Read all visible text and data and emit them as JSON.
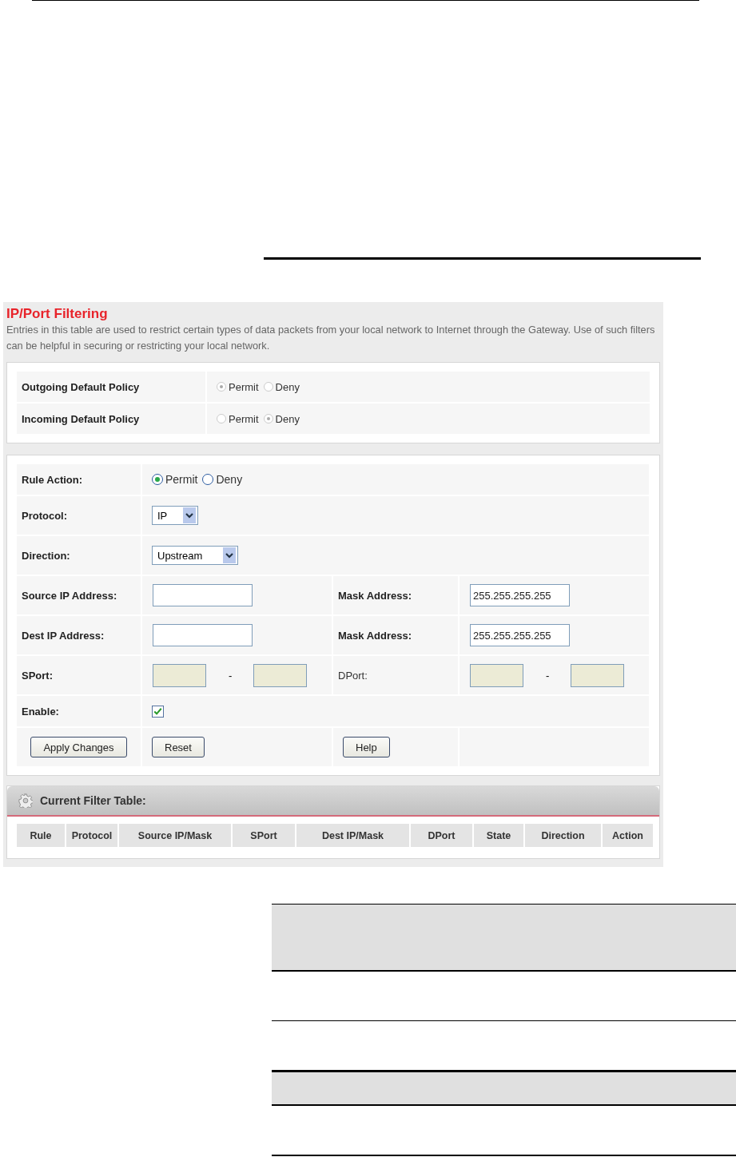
{
  "panel": {
    "title": "IP/Port Filtering",
    "description": "Entries in this table are used to restrict certain types of data packets from your local network to Internet through the Gateway. Use of such filters can be helpful in securing or restricting your local network."
  },
  "policies": [
    {
      "label": "Outgoing Default Policy",
      "disabled": true,
      "options": [
        {
          "label": "Permit",
          "selected": true
        },
        {
          "label": "Deny",
          "selected": false
        }
      ]
    },
    {
      "label": "Incoming Default Policy",
      "disabled": true,
      "options": [
        {
          "label": "Permit",
          "selected": false
        },
        {
          "label": "Deny",
          "selected": true
        }
      ]
    }
  ],
  "form_rows": [
    {
      "kind": "radio",
      "label": "Rule Action:",
      "options": [
        {
          "label": "Permit",
          "selected": true
        },
        {
          "label": "Deny",
          "selected": false
        }
      ]
    },
    {
      "kind": "select",
      "label": "Protocol:",
      "value": "IP"
    },
    {
      "kind": "select",
      "label": "Direction:",
      "value": "Upstream"
    },
    {
      "kind": "address",
      "label": "Source IP Address:",
      "mask_label": "Mask Address:",
      "mask_value": "255.255.255.255"
    },
    {
      "kind": "address",
      "label": "Dest IP Address:",
      "mask_label": "Mask Address:",
      "mask_value": "255.255.255.255"
    },
    {
      "kind": "ports",
      "label": "SPort:",
      "separator": "-",
      "right_label": "DPort:",
      "right_separator": "-",
      "disabled": true
    },
    {
      "kind": "checkbox",
      "label": "Enable:",
      "checked": true
    }
  ],
  "buttons": [
    "Apply Changes",
    "Reset",
    "Help"
  ],
  "filter_table": {
    "title": "Current Filter Table:",
    "columns": [
      "Rule",
      "Protocol",
      "Source IP/Mask",
      "SPort",
      "Dest IP/Mask",
      "DPort",
      "State",
      "Direction",
      "Action"
    ]
  }
}
